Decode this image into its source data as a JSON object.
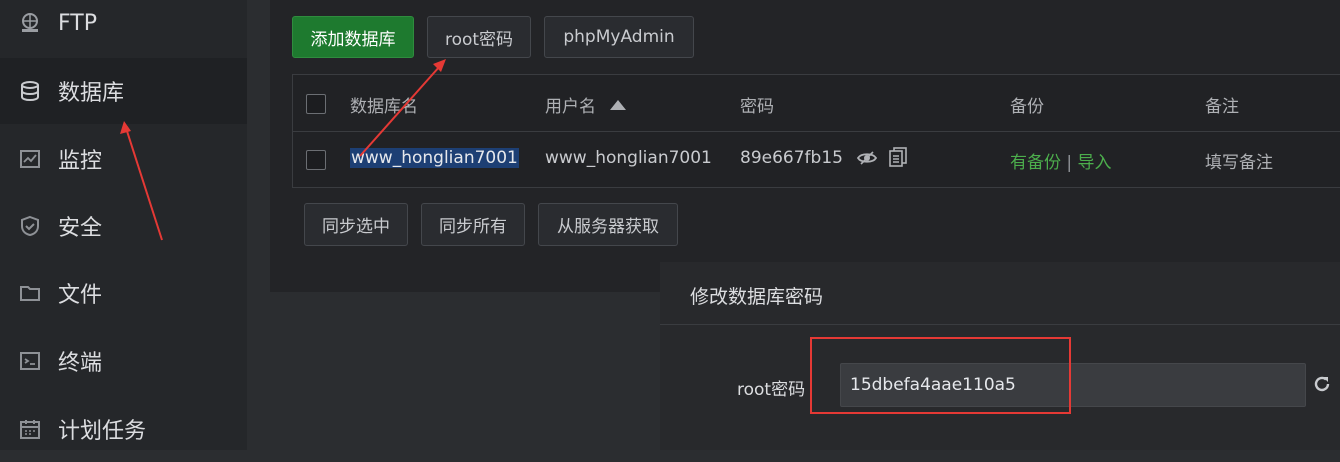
{
  "sidebar": {
    "items": [
      {
        "label": "FTP",
        "icon": "ftp-globe-icon",
        "active": false
      },
      {
        "label": "数据库",
        "icon": "database-icon",
        "active": true
      },
      {
        "label": "监控",
        "icon": "monitor-chart-icon",
        "active": false
      },
      {
        "label": "安全",
        "icon": "shield-icon",
        "active": false
      },
      {
        "label": "文件",
        "icon": "folder-icon",
        "active": false
      },
      {
        "label": "终端",
        "icon": "terminal-icon",
        "active": false
      },
      {
        "label": "计划任务",
        "icon": "calendar-icon",
        "active": false
      }
    ]
  },
  "toolbar": {
    "add_db": "添加数据库",
    "root_pwd": "root密码",
    "phpmyadmin": "phpMyAdmin"
  },
  "table": {
    "headers": {
      "name": "数据库名",
      "user": "用户名",
      "password": "密码",
      "backup": "备份",
      "note": "备注"
    },
    "rows": [
      {
        "name": "www_honglian7001",
        "user": "www_honglian7001",
        "password": "89e667fb15",
        "backup_status": "有备份",
        "backup_sep": "|",
        "import": "导入",
        "note": "填写备注"
      }
    ]
  },
  "actions": {
    "sync_selected": "同步选中",
    "sync_all": "同步所有",
    "fetch_server": "从服务器获取"
  },
  "modal": {
    "title": "修改数据库密码",
    "field_label": "root密码",
    "field_value": "15dbefa4aae110a5"
  },
  "colors": {
    "accent_green": "#4cae4c",
    "annotation_red": "#e53935",
    "selection_blue": "#1d3f74"
  }
}
